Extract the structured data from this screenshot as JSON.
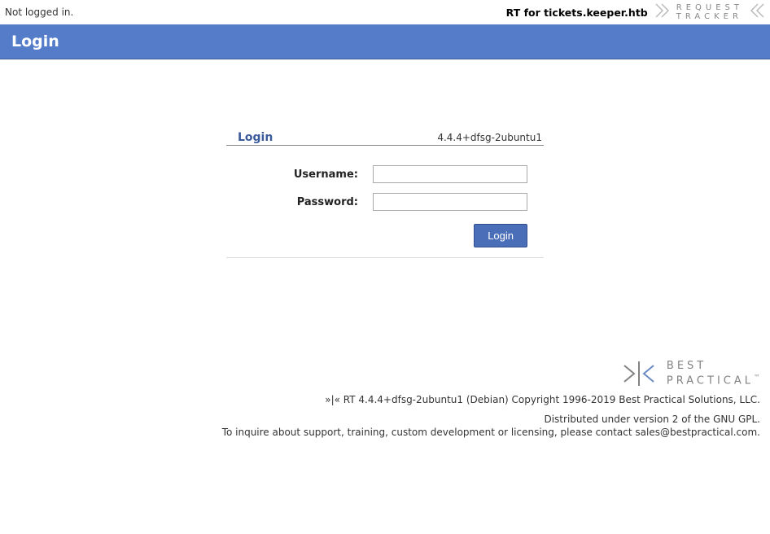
{
  "topbar": {
    "not_logged_in": "Not logged in.",
    "rt_for": "RT for tickets.keeper.htb",
    "logo_line1": "REQUEST",
    "logo_line2": "TRACKER"
  },
  "header": {
    "title": "Login"
  },
  "login_box": {
    "title": "Login",
    "version": "4.4.4+dfsg-2ubuntu1",
    "username_label": "Username:",
    "password_label": "Password:",
    "username_value": "",
    "password_value": "",
    "submit_label": "Login"
  },
  "footer": {
    "bp_line1": "BEST",
    "bp_line2": "PRACTICAL",
    "copyright": "»|« RT 4.4.4+dfsg-2ubuntu1 (Debian) Copyright 1996-2019 Best Practical Solutions, LLC.",
    "license": "Distributed under version 2 of the GNU GPL.",
    "contact": "To inquire about support, training, custom development or licensing, please contact sales@bestpractical.com."
  }
}
